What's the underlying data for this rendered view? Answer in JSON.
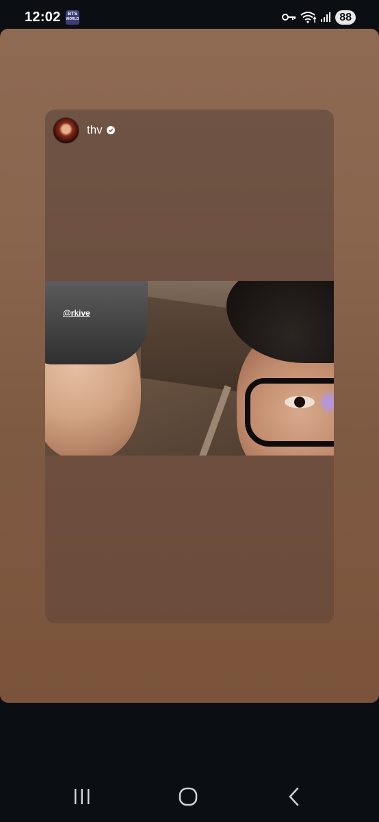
{
  "status_bar": {
    "time": "12:02",
    "app_badge": {
      "line1": "BTS",
      "line2": "WORLD"
    },
    "battery_level": "88",
    "icons": [
      "key-icon",
      "wifi-icon",
      "signal-icon",
      "battery-icon"
    ]
  },
  "story": {
    "post": {
      "username": "thv",
      "verified": true,
      "photo": {
        "sticker_label": "@rkive"
      }
    }
  },
  "nav_bar": {
    "icons": [
      "recent-apps-icon",
      "home-icon",
      "back-icon"
    ]
  },
  "colors": {
    "background": "#0b0f14",
    "story_top": "#8f6a53",
    "story_bottom": "#7b533b",
    "battery_bg": "#e8e8e8",
    "text": "#ffffff"
  }
}
